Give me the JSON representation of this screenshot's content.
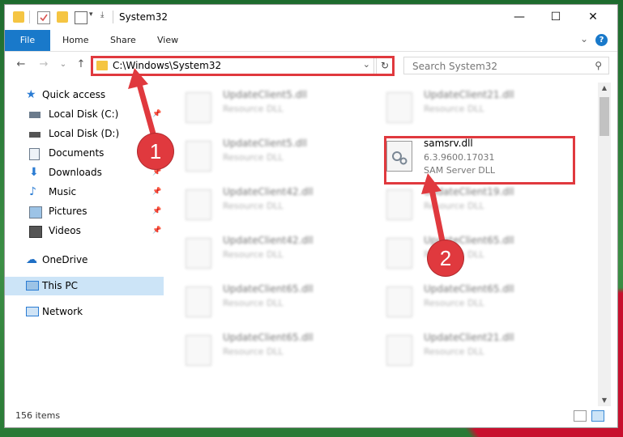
{
  "window": {
    "title": "System32",
    "minimize": "—",
    "maximize": "☐",
    "close": "✕"
  },
  "ribbon": {
    "tabs": [
      "File",
      "Home",
      "Share",
      "View"
    ],
    "collapse": "⌄",
    "help": "?"
  },
  "address": {
    "path": "C:\\Windows\\System32",
    "dropdown": "⌄",
    "refresh": "↻"
  },
  "nav_buttons": {
    "back": "←",
    "forward": "→",
    "recent": "⌄",
    "up": "↑"
  },
  "search": {
    "placeholder": "Search System32"
  },
  "sidebar": {
    "quick_access": "Quick access",
    "items": [
      {
        "label": "Local Disk (C:)",
        "icon": "drive-icon"
      },
      {
        "label": "Local Disk (D:)",
        "icon": "drive-icon"
      },
      {
        "label": "Documents",
        "icon": "documents-icon"
      },
      {
        "label": "Downloads",
        "icon": "downloads-icon"
      },
      {
        "label": "Music",
        "icon": "music-icon"
      },
      {
        "label": "Pictures",
        "icon": "pictures-icon"
      },
      {
        "label": "Videos",
        "icon": "videos-icon"
      }
    ],
    "onedrive": "OneDrive",
    "this_pc": "This PC",
    "network": "Network"
  },
  "files_left": [
    {
      "name": "UpdateClient5.dll",
      "type": "Resource DLL"
    },
    {
      "name": "UpdateClient5.dll",
      "type": "Resource DLL"
    },
    {
      "name": "UpdateClient42.dll",
      "type": "Resource DLL"
    },
    {
      "name": "UpdateClient42.dll",
      "type": "Resource DLL"
    },
    {
      "name": "UpdateClient65.dll",
      "type": "Resource DLL"
    },
    {
      "name": "UpdateClient65.dll",
      "type": "Resource DLL"
    }
  ],
  "files_right": [
    {
      "name": "UpdateClient21.dll",
      "type": "Resource DLL"
    },
    {
      "name": "UpdateClient19.dll",
      "type": "Resource DLL"
    },
    {
      "name": "UpdateClient65.dll",
      "type": "Resource DLL"
    },
    {
      "name": "UpdateClient65.dll",
      "type": "Resource DLL"
    },
    {
      "name": "UpdateClient21.dll",
      "type": "Resource DLL"
    }
  ],
  "highlighted_file": {
    "name": "samsrv.dll",
    "version": "6.3.9600.17031",
    "description": "SAM Server DLL"
  },
  "status": {
    "count": "156 items"
  },
  "annotations": {
    "step1": "1",
    "step2": "2",
    "color": "#e0393e"
  }
}
